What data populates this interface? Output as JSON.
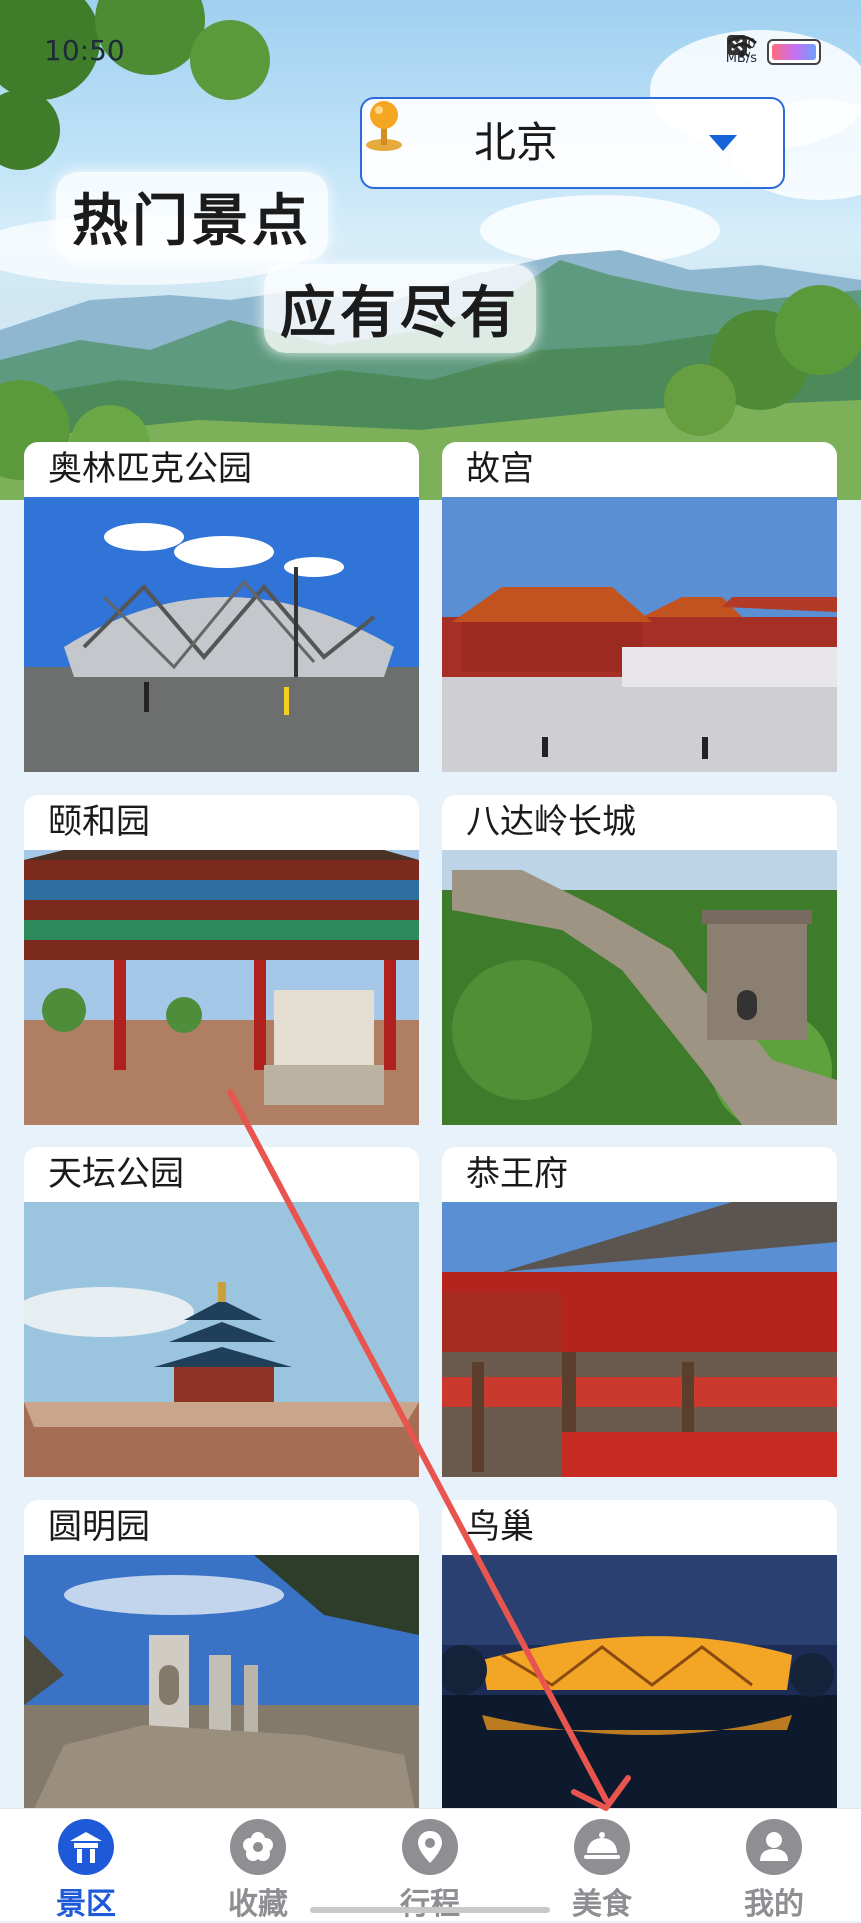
{
  "status_bar": {
    "time": "10:50",
    "net_speed": "2.00",
    "net_unit": "MB/s"
  },
  "header": {
    "city": "北京",
    "slogan_line1": "热门景点",
    "slogan_line2": "应有尽有"
  },
  "attractions": [
    {
      "name": "奥林匹克公园"
    },
    {
      "name": "故宫"
    },
    {
      "name": "颐和园"
    },
    {
      "name": "八达岭长城"
    },
    {
      "name": "天坛公园"
    },
    {
      "name": "恭王府"
    },
    {
      "name": "圆明园"
    },
    {
      "name": "鸟巢"
    }
  ],
  "tabbar": {
    "tabs": [
      {
        "label": "景区",
        "icon": "temple-icon",
        "active": true
      },
      {
        "label": "收藏",
        "icon": "flower-icon",
        "active": false
      },
      {
        "label": "行程",
        "icon": "map-pin-icon",
        "active": false
      },
      {
        "label": "美食",
        "icon": "cloche-icon",
        "active": false
      },
      {
        "label": "我的",
        "icon": "user-icon",
        "active": false
      }
    ]
  },
  "colors": {
    "accent": "#1e5ad8",
    "inactive": "#8e8e93",
    "annotation_arrow": "#e8554e"
  }
}
